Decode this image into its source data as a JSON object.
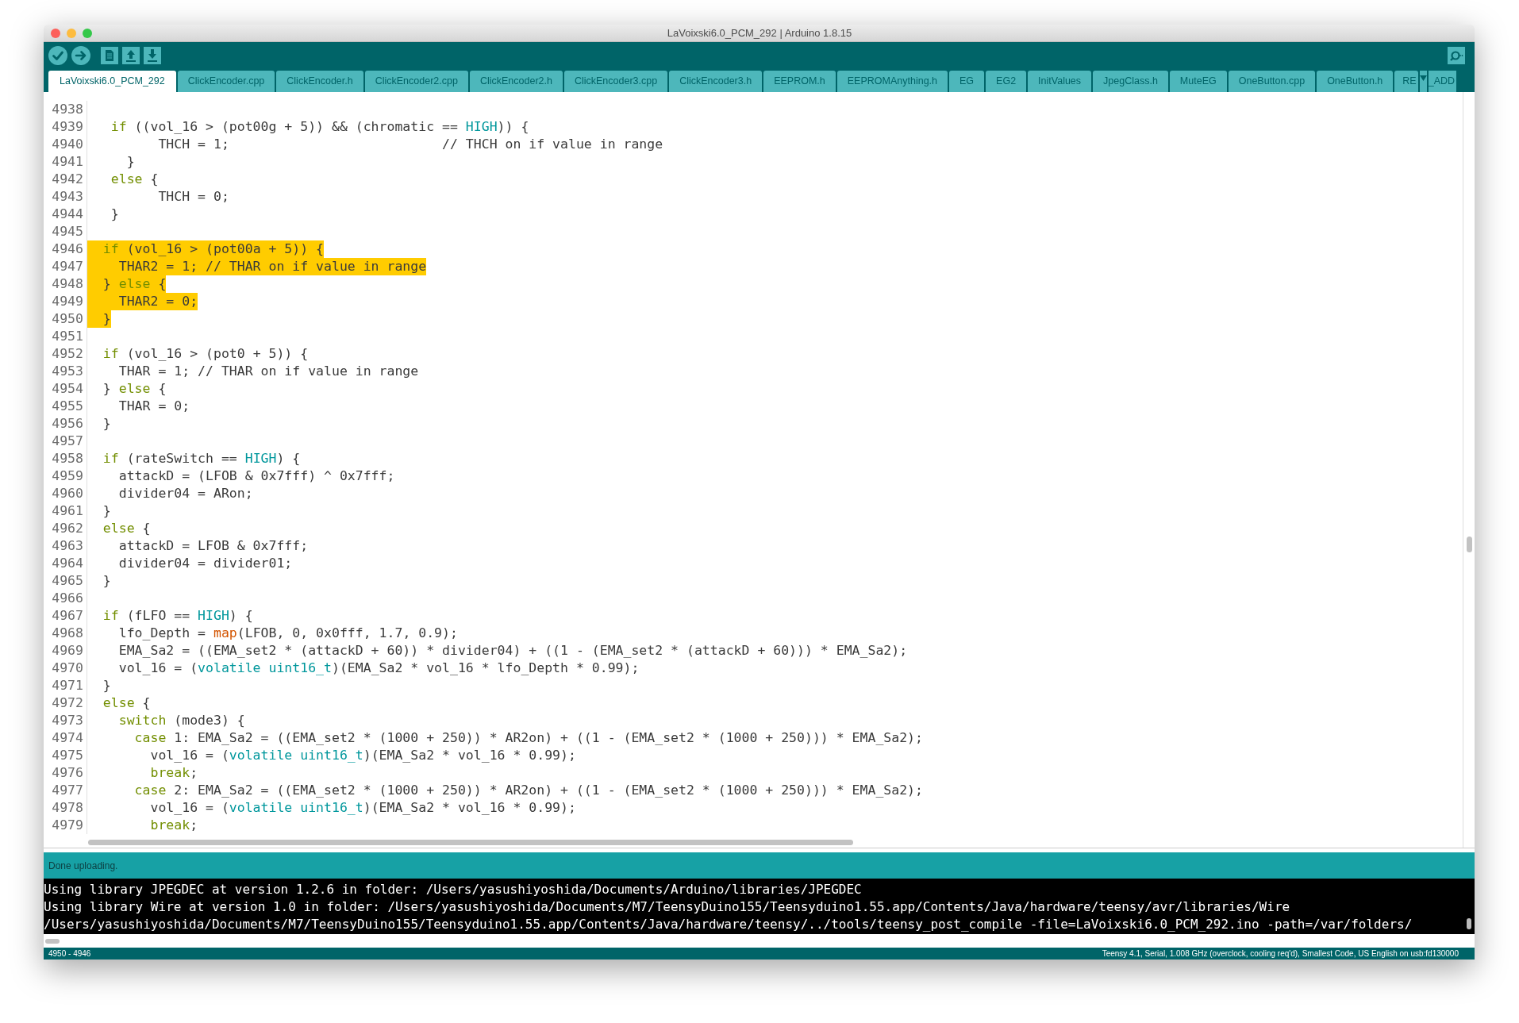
{
  "window": {
    "title": "LaVoixski6.0_PCM_292 | Arduino 1.8.15"
  },
  "tabs": [
    {
      "label": "LaVoixski6.0_PCM_292",
      "selected": true
    },
    {
      "label": "ClickEncoder.cpp",
      "selected": false
    },
    {
      "label": "ClickEncoder.h",
      "selected": false
    },
    {
      "label": "ClickEncoder2.cpp",
      "selected": false
    },
    {
      "label": "ClickEncoder2.h",
      "selected": false
    },
    {
      "label": "ClickEncoder3.cpp",
      "selected": false
    },
    {
      "label": "ClickEncoder3.h",
      "selected": false
    },
    {
      "label": "EEPROM.h",
      "selected": false
    },
    {
      "label": "EEPROMAnything.h",
      "selected": false
    },
    {
      "label": "EG",
      "selected": false
    },
    {
      "label": "EG2",
      "selected": false
    },
    {
      "label": "InitValues",
      "selected": false
    },
    {
      "label": "JpegClass.h",
      "selected": false
    },
    {
      "label": "MuteEG",
      "selected": false
    },
    {
      "label": "OneButton.cpp",
      "selected": false
    },
    {
      "label": "OneButton.h",
      "selected": false
    },
    {
      "label": "RE",
      "selected": false
    }
  ],
  "overflow_tab_text": "_ADD",
  "editor": {
    "lines": [
      {
        "number": "4938",
        "selected": false
      },
      {
        "number": "4939",
        "selected": false,
        "segments": [
          {
            "kind": "keyword",
            "text": "   if"
          },
          {
            "kind": "plain",
            "text": " ((vol_16 > (pot00g + 5)) && (chromatic == "
          },
          {
            "kind": "constant",
            "text": "HIGH"
          },
          {
            "kind": "plain",
            "text": ")) {"
          }
        ]
      },
      {
        "number": "4940",
        "selected": false,
        "segments": [
          {
            "kind": "plain",
            "text": "         THCH = 1;                           // THCH on if value in range"
          }
        ]
      },
      {
        "number": "4941",
        "selected": false,
        "segments": [
          {
            "kind": "plain",
            "text": "     }"
          }
        ]
      },
      {
        "number": "4942",
        "selected": false,
        "segments": [
          {
            "kind": "keyword",
            "text": "   else"
          },
          {
            "kind": "plain",
            "text": " {"
          }
        ]
      },
      {
        "number": "4943",
        "selected": false,
        "segments": [
          {
            "kind": "plain",
            "text": "         THCH = 0;"
          }
        ]
      },
      {
        "number": "4944",
        "selected": false,
        "segments": [
          {
            "kind": "plain",
            "text": "   }"
          }
        ]
      },
      {
        "number": "4945",
        "selected": false
      },
      {
        "number": "4946",
        "selected": true,
        "segments": [
          {
            "kind": "keyword",
            "text": "  if"
          },
          {
            "kind": "plain",
            "text": " (vol_16 > (pot00a + 5)) {"
          }
        ]
      },
      {
        "number": "4947",
        "selected": true,
        "segments": [
          {
            "kind": "plain",
            "text": "    THAR2 = 1; // THAR on if value in range"
          }
        ]
      },
      {
        "number": "4948",
        "selected": true,
        "segments": [
          {
            "kind": "plain",
            "text": "  } "
          },
          {
            "kind": "keyword",
            "text": "else"
          },
          {
            "kind": "plain",
            "text": " {"
          }
        ]
      },
      {
        "number": "4949",
        "selected": true,
        "segments": [
          {
            "kind": "plain",
            "text": "    THAR2 = 0;"
          }
        ]
      },
      {
        "number": "4950",
        "selected": true,
        "segments": [
          {
            "kind": "plain",
            "text": "  }"
          }
        ]
      },
      {
        "number": "4951",
        "selected": false
      },
      {
        "number": "4952",
        "selected": false,
        "segments": [
          {
            "kind": "keyword",
            "text": "  if"
          },
          {
            "kind": "plain",
            "text": " (vol_16 > (pot0 + 5)) {"
          }
        ]
      },
      {
        "number": "4953",
        "selected": false,
        "segments": [
          {
            "kind": "plain",
            "text": "    THAR = 1; // THAR on if value in range"
          }
        ]
      },
      {
        "number": "4954",
        "selected": false,
        "segments": [
          {
            "kind": "plain",
            "text": "  } "
          },
          {
            "kind": "keyword",
            "text": "else"
          },
          {
            "kind": "plain",
            "text": " {"
          }
        ]
      },
      {
        "number": "4955",
        "selected": false,
        "segments": [
          {
            "kind": "plain",
            "text": "    THAR = 0;"
          }
        ]
      },
      {
        "number": "4956",
        "selected": false,
        "segments": [
          {
            "kind": "plain",
            "text": "  }"
          }
        ]
      },
      {
        "number": "4957",
        "selected": false
      },
      {
        "number": "4958",
        "selected": false,
        "segments": [
          {
            "kind": "keyword",
            "text": "  if"
          },
          {
            "kind": "plain",
            "text": " (rateSwitch == "
          },
          {
            "kind": "constant",
            "text": "HIGH"
          },
          {
            "kind": "plain",
            "text": ") {"
          }
        ]
      },
      {
        "number": "4959",
        "selected": false,
        "segments": [
          {
            "kind": "plain",
            "text": "    attackD = (LFOB & 0x7fff) ^ 0x7fff;"
          }
        ]
      },
      {
        "number": "4960",
        "selected": false,
        "segments": [
          {
            "kind": "plain",
            "text": "    divider04 = ARon;"
          }
        ]
      },
      {
        "number": "4961",
        "selected": false,
        "segments": [
          {
            "kind": "plain",
            "text": "  }"
          }
        ]
      },
      {
        "number": "4962",
        "selected": false,
        "segments": [
          {
            "kind": "keyword",
            "text": "  else"
          },
          {
            "kind": "plain",
            "text": " {"
          }
        ]
      },
      {
        "number": "4963",
        "selected": false,
        "segments": [
          {
            "kind": "plain",
            "text": "    attackD = LFOB & 0x7fff;"
          }
        ]
      },
      {
        "number": "4964",
        "selected": false,
        "segments": [
          {
            "kind": "plain",
            "text": "    divider04 = divider01;"
          }
        ]
      },
      {
        "number": "4965",
        "selected": false,
        "segments": [
          {
            "kind": "plain",
            "text": "  }"
          }
        ]
      },
      {
        "number": "4966",
        "selected": false
      },
      {
        "number": "4967",
        "selected": false,
        "segments": [
          {
            "kind": "keyword",
            "text": "  if"
          },
          {
            "kind": "plain",
            "text": " (fLFO == "
          },
          {
            "kind": "constant",
            "text": "HIGH"
          },
          {
            "kind": "plain",
            "text": ") {"
          }
        ]
      },
      {
        "number": "4968",
        "selected": false,
        "segments": [
          {
            "kind": "plain",
            "text": "    lfo_Depth = "
          },
          {
            "kind": "function",
            "text": "map"
          },
          {
            "kind": "plain",
            "text": "(LFOB, 0, 0x0fff, 1.7, 0.9);"
          }
        ]
      },
      {
        "number": "4969",
        "selected": false,
        "segments": [
          {
            "kind": "plain",
            "text": "    EMA_Sa2 = ((EMA_set2 * (attackD + 60)) * divider04) + ((1 - (EMA_set2 * (attackD + 60))) * EMA_Sa2);"
          }
        ]
      },
      {
        "number": "4970",
        "selected": false,
        "segments": [
          {
            "kind": "plain",
            "text": "    vol_16 = ("
          },
          {
            "kind": "constant",
            "text": "volatile uint16_t"
          },
          {
            "kind": "plain",
            "text": ")(EMA_Sa2 * vol_16 * lfo_Depth * 0.99);"
          }
        ]
      },
      {
        "number": "4971",
        "selected": false,
        "segments": [
          {
            "kind": "plain",
            "text": "  }"
          }
        ]
      },
      {
        "number": "4972",
        "selected": false,
        "segments": [
          {
            "kind": "keyword",
            "text": "  else"
          },
          {
            "kind": "plain",
            "text": " {"
          }
        ]
      },
      {
        "number": "4973",
        "selected": false,
        "segments": [
          {
            "kind": "keyword",
            "text": "    switch"
          },
          {
            "kind": "plain",
            "text": " (mode3) {"
          }
        ]
      },
      {
        "number": "4974",
        "selected": false,
        "segments": [
          {
            "kind": "keyword",
            "text": "      case"
          },
          {
            "kind": "plain",
            "text": " 1: EMA_Sa2 = ((EMA_set2 * (1000 + 250)) * AR2on) + ((1 - (EMA_set2 * (1000 + 250))) * EMA_Sa2);"
          }
        ]
      },
      {
        "number": "4975",
        "selected": false,
        "segments": [
          {
            "kind": "plain",
            "text": "        vol_16 = ("
          },
          {
            "kind": "constant",
            "text": "volatile uint16_t"
          },
          {
            "kind": "plain",
            "text": ")(EMA_Sa2 * vol_16 * 0.99);"
          }
        ]
      },
      {
        "number": "4976",
        "selected": false,
        "segments": [
          {
            "kind": "keyword",
            "text": "        break"
          },
          {
            "kind": "plain",
            "text": ";"
          }
        ]
      },
      {
        "number": "4977",
        "selected": false,
        "segments": [
          {
            "kind": "keyword",
            "text": "      case"
          },
          {
            "kind": "plain",
            "text": " 2: EMA_Sa2 = ((EMA_set2 * (1000 + 250)) * AR2on) + ((1 - (EMA_set2 * (1000 + 250))) * EMA_Sa2);"
          }
        ]
      },
      {
        "number": "4978",
        "selected": false,
        "segments": [
          {
            "kind": "plain",
            "text": "        vol_16 = ("
          },
          {
            "kind": "constant",
            "text": "volatile uint16_t"
          },
          {
            "kind": "plain",
            "text": ")(EMA_Sa2 * vol_16 * 0.99);"
          }
        ]
      },
      {
        "number": "4979",
        "selected": false,
        "segments": [
          {
            "kind": "keyword",
            "text": "        break"
          },
          {
            "kind": "plain",
            "text": ";"
          }
        ]
      }
    ]
  },
  "message": "Done uploading.",
  "console": [
    "Using library JPEGDEC at version 1.2.6 in folder: /Users/yasushiyoshida/Documents/Arduino/libraries/JPEGDEC",
    "Using library Wire at version 1.0 in folder: /Users/yasushiyoshida/Documents/M7/TeensyDuino155/Teensyduino1.55.app/Contents/Java/hardware/teensy/avr/libraries/Wire",
    "/Users/yasushiyoshida/Documents/M7/TeensyDuino155/Teensyduino1.55.app/Contents/Java/hardware/teensy/../tools/teensy_post_compile -file=LaVoixski6.0_PCM_292.ino -path=/var/folders/"
  ],
  "status_bar": {
    "lines": "4950 - 4946",
    "board": "Teensy 4.1, Serial, 1.008 GHz (overclock, cooling req'd), Smallest Code, US English on usb:fd130000"
  }
}
